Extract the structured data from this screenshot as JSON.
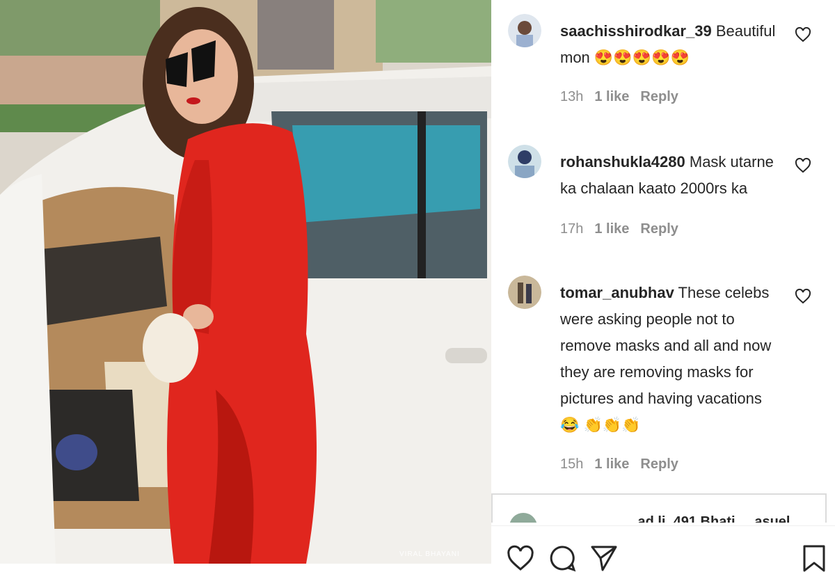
{
  "photo": {
    "watermark": "VIRAL BHAYANI"
  },
  "comments": [
    {
      "username": "saachisshirodkar_39",
      "text": " Beautiful mon 😍😍😍😍😍",
      "time": "13h",
      "likes": "1 like",
      "reply": "Reply"
    },
    {
      "username": "rohanshukla4280",
      "text": " Mask utarne ka chalaan kaato 2000rs ka",
      "time": "17h",
      "likes": "1 like",
      "reply": "Reply"
    },
    {
      "username": "tomar_anubhav",
      "text": " These celebs were asking people not to remove masks and all and now they are removing masks for pictures and having vacations 😂 👏👏👏",
      "time": "15h",
      "likes": "1 like",
      "reply": "Reply"
    }
  ],
  "next_comment_peek": "____________ad.li_491 Bhati.....asuel ...",
  "icons": {
    "heart": "heart-outline-icon",
    "comment": "comment-bubble-icon",
    "share": "paper-plane-icon",
    "save": "bookmark-icon"
  },
  "colors": {
    "text": "#262626",
    "meta": "#8e8e8e",
    "dress": "#e0261e"
  }
}
